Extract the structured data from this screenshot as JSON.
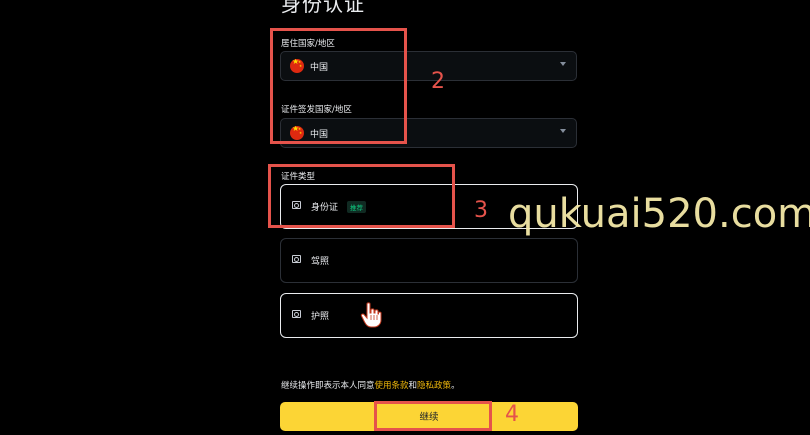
{
  "page_title": "身份认证",
  "residence": {
    "label": "居住国家/地区",
    "value": "中国"
  },
  "issuing": {
    "label": "证件签发国家/地区",
    "value": "中国"
  },
  "doc_type": {
    "label": "证件类型",
    "options": [
      {
        "label": "身份证",
        "tag": "推荐",
        "icon": "id-card-icon"
      },
      {
        "label": "驾照",
        "icon": "license-icon"
      },
      {
        "label": "护照",
        "icon": "passport-icon"
      }
    ]
  },
  "consent": {
    "prefix": "继续操作即表示本人同意",
    "terms": "使用条款",
    "and": "和",
    "privacy": "隐私政策",
    "suffix": "。"
  },
  "continue_label": "继续",
  "annotations": {
    "n2": "2",
    "n3": "3",
    "n4": "4"
  },
  "watermark": "qukuai520.com",
  "colors": {
    "accent": "#fcd535",
    "annotation": "#e5534b",
    "tag_green": "#0ecb81"
  }
}
